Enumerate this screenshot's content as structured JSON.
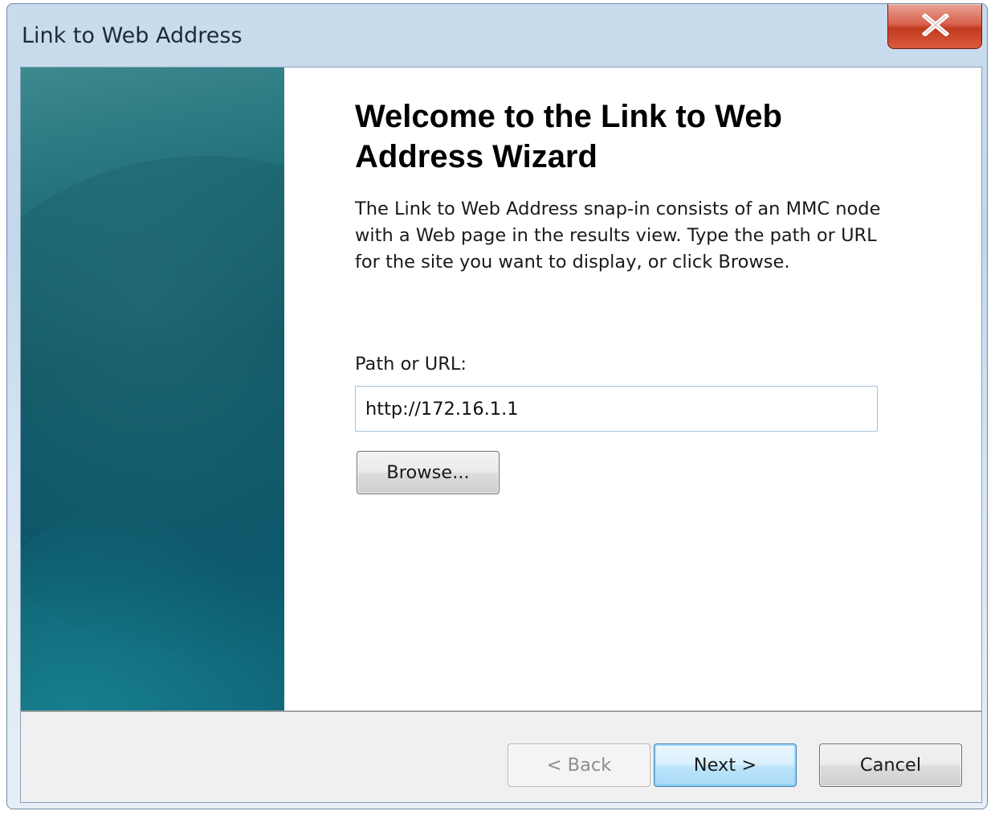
{
  "window": {
    "title": "Link to Web Address",
    "close_icon": "close-icon"
  },
  "wizard": {
    "heading": "Welcome to the Link to Web Address Wizard",
    "description": "The Link to Web Address snap-in consists of an MMC node with a Web page in the results view. Type the path or URL for the site you want to display, or click Browse.",
    "path_label": "Path or URL:",
    "path_value": "http://172.16.1.1",
    "browse_label": "Browse..."
  },
  "footer": {
    "back_label": "< Back",
    "next_label": "Next >",
    "cancel_label": "Cancel"
  },
  "colors": {
    "side_panel": "#0f5867",
    "close_button": "#c23a21",
    "default_button_border": "#3c7fb1"
  }
}
